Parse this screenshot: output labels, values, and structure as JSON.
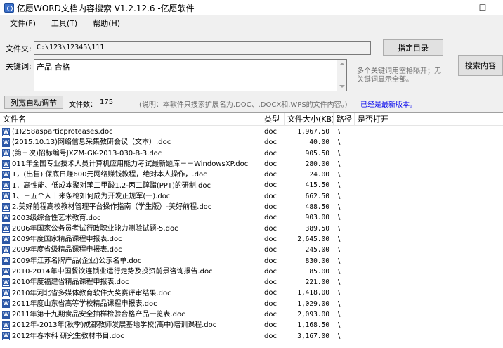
{
  "window": {
    "title": "亿愿WORD文档内容搜索 V1.2.12.6 -亿愿软件",
    "minimize": "—",
    "maximize": "☐"
  },
  "menu": [
    "文件(F)",
    "工具(T)",
    "帮助(H)"
  ],
  "form": {
    "folder_label": "文件夹:",
    "folder_value": "C:\\123\\12345\\111",
    "keyword_label": "关键词:",
    "keyword_value": "产品 合格",
    "hint": "多个关键词用空格隔开；无关键词显示全部。",
    "select_dir_button": "指定目录",
    "search_button": "搜索内容"
  },
  "info": {
    "auto_adjust_button": "列宽自动调节",
    "file_count_label": "文件数：",
    "file_count": "175",
    "note": "(说明：本软件只搜索扩展名为.DOC、.DOCX和.WPS的文件内容。)",
    "latest_link": "已经是最新版本。"
  },
  "table": {
    "headers": [
      "文件名",
      "类型",
      "文件大小(KB)",
      "路径",
      "是否打开"
    ],
    "rows": [
      {
        "name": "(1)258asparticproteases.doc",
        "type": "doc",
        "size": "1,967.50",
        "path": "\\"
      },
      {
        "name": "(2015.10.13)网络信息采集教研会议（文本）.doc",
        "type": "doc",
        "size": "40.00",
        "path": "\\"
      },
      {
        "name": "(第三次)招标编号JXZM-GK-2013-030-B-3.doc",
        "type": "doc",
        "size": "905.50",
        "path": "\\"
      },
      {
        "name": "011年全国专业技术人员计算机应用能力考试最新题库－－WindowsXP.doc",
        "type": "doc",
        "size": "280.00",
        "path": "\\"
      },
      {
        "name": "1，(出售) 保底日赚600元网络赚钱教程，绝对本人操作，.doc",
        "type": "doc",
        "size": "24.00",
        "path": "\\"
      },
      {
        "name": "1．高性能、低成本聚对苯二甲酸1,2-丙二醇酯(PPT)的研制.doc",
        "type": "doc",
        "size": "415.50",
        "path": "\\"
      },
      {
        "name": "1、三五个人十来条枪如何成为开发正规军(一).doc",
        "type": "doc",
        "size": "662.50",
        "path": "\\"
      },
      {
        "name": "2.美好前程高校教材管理平台操作指南（学生版）-美好前程.doc",
        "type": "doc",
        "size": "488.50",
        "path": "\\"
      },
      {
        "name": "2003级综合性艺术教育.doc",
        "type": "doc",
        "size": "903.00",
        "path": "\\"
      },
      {
        "name": "2006年国家公务员考试行政职业能力测验试题-5.doc",
        "type": "doc",
        "size": "389.50",
        "path": "\\"
      },
      {
        "name": "2009年度国家精品课程申报表.doc",
        "type": "doc",
        "size": "2,645.00",
        "path": "\\"
      },
      {
        "name": "2009年度省级精品课程申报表.doc",
        "type": "doc",
        "size": "245.00",
        "path": "\\"
      },
      {
        "name": "2009年江苏名牌产品(企业)公示名单.doc",
        "type": "doc",
        "size": "830.00",
        "path": "\\"
      },
      {
        "name": "2010-2014年中国餐饮连锁业运行走势及投资前景咨询报告.doc",
        "type": "doc",
        "size": "85.00",
        "path": "\\"
      },
      {
        "name": "2010年度福建省精品课程申报表.doc",
        "type": "doc",
        "size": "221.00",
        "path": "\\"
      },
      {
        "name": "2010年河北省多媒体教育软件大奖赛评审结果.doc",
        "type": "doc",
        "size": "1,418.00",
        "path": "\\"
      },
      {
        "name": "2011年度山东省高等学校精品课程申报表.doc",
        "type": "doc",
        "size": "1,029.00",
        "path": "\\"
      },
      {
        "name": "2011年第十九期食品安全抽样检验合格产品一览表.doc",
        "type": "doc",
        "size": "2,093.00",
        "path": "\\"
      },
      {
        "name": "2012年-2013年(秋季)成都教师发展基地学校(高中)培训课程.doc",
        "type": "doc",
        "size": "1,168.50",
        "path": "\\"
      },
      {
        "name": "2012年春本科 研究生教材书目.doc",
        "type": "doc",
        "size": "3,167.00",
        "path": "\\"
      }
    ]
  }
}
